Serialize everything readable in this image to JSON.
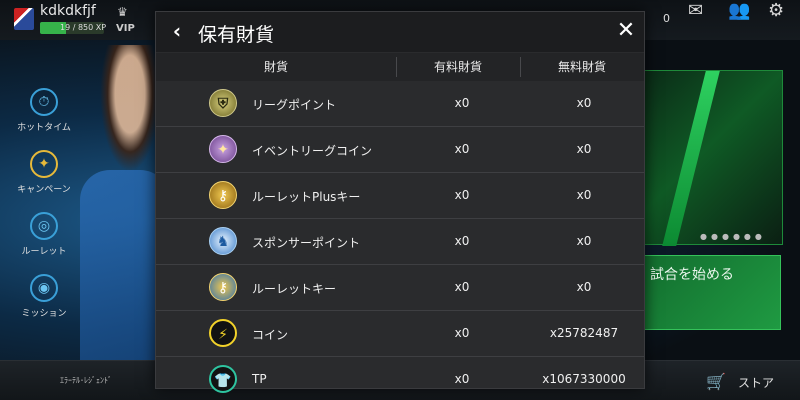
{
  "background": {
    "player_name": "kdkdkfjf",
    "player_level_text": "19 / 850 XP",
    "vip_label": "VIP",
    "coin_count": "0",
    "side_menu": [
      {
        "label": "ホットタイム",
        "icon": "stopwatch-icon"
      },
      {
        "label": "キャンペーン",
        "icon": "party-popper-icon"
      },
      {
        "label": "ルーレット",
        "icon": "roulette-icon"
      },
      {
        "label": "ミッション",
        "icon": "target-icon"
      }
    ],
    "start_match_label": "試合を始める",
    "bottom_left_text": "ｴﾗｰﾃﾙ･ﾚｼﾞｪﾝﾄﾞ",
    "store_label": "ストア"
  },
  "modal": {
    "title": "保有財貨",
    "back_icon": "back-chevron-icon",
    "close_icon": "close-icon",
    "columns": [
      "財貨",
      "有料財貨",
      "無料財貨"
    ],
    "rows": [
      {
        "name": "リーグポイント",
        "paid": "x0",
        "free": "x0",
        "icon": "league-point-icon"
      },
      {
        "name": "イベントリーグコイン",
        "paid": "x0",
        "free": "x0",
        "icon": "event-league-coin-icon"
      },
      {
        "name": "ルーレットPlusキー",
        "paid": "x0",
        "free": "x0",
        "icon": "roulette-plus-key-icon"
      },
      {
        "name": "スポンサーポイント",
        "paid": "x0",
        "free": "x0",
        "icon": "sponsor-point-icon"
      },
      {
        "name": "ルーレットキー",
        "paid": "x0",
        "free": "x0",
        "icon": "roulette-key-icon"
      },
      {
        "name": "コイン",
        "paid": "x0",
        "free": "x25782487",
        "icon": "coin-icon"
      },
      {
        "name": "TP",
        "paid": "x0",
        "free": "x1067330000",
        "icon": "tp-icon"
      }
    ]
  },
  "colors": {
    "modal_bg": "#2a2b2d",
    "header_bg": "#1c1d1f",
    "accent_green": "#1f9a42"
  }
}
